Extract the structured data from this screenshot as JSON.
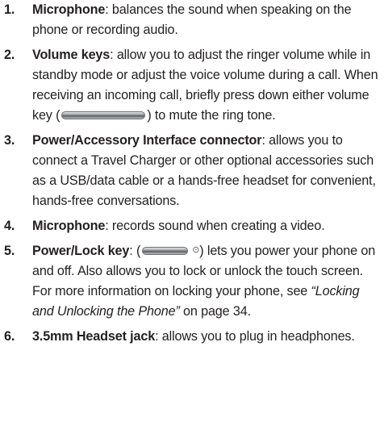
{
  "items": [
    {
      "num": "1.",
      "term": "Microphone",
      "text": ": balances the sound when speaking on the phone or recording audio."
    },
    {
      "num": "2.",
      "term": "Volume keys",
      "text_before": ": allow you to adjust the ringer volume while in standby mode or adjust the voice volume during a call. When receiving an incoming call, briefly press down either volume key (",
      "text_after": ") to mute the ring tone.",
      "icon": "volume-key-icon"
    },
    {
      "num": "3.",
      "term": "Power/Accessory Interface connector",
      "text": ": allows you to connect a Travel Charger or other optional accessories such as a USB/data cable or a hands-free headset for convenient, hands-free conversations."
    },
    {
      "num": "4.",
      "term": "Microphone",
      "text": ": records sound when creating a video."
    },
    {
      "num": "5.",
      "term": "Power/Lock key",
      "text_before": ": (",
      "symbol": "⊙",
      "text_mid": ") lets you power your phone on and off. Also allows you to lock or unlock the touch screen. For more information on locking your phone, see ",
      "ref": "“Locking and Unlocking the Phone”",
      "text_after": " on page 34.",
      "icon": "power-key-icon"
    },
    {
      "num": "6.",
      "term": "3.5mm Headset jack",
      "text": ": allows you to plug in headphones."
    }
  ]
}
